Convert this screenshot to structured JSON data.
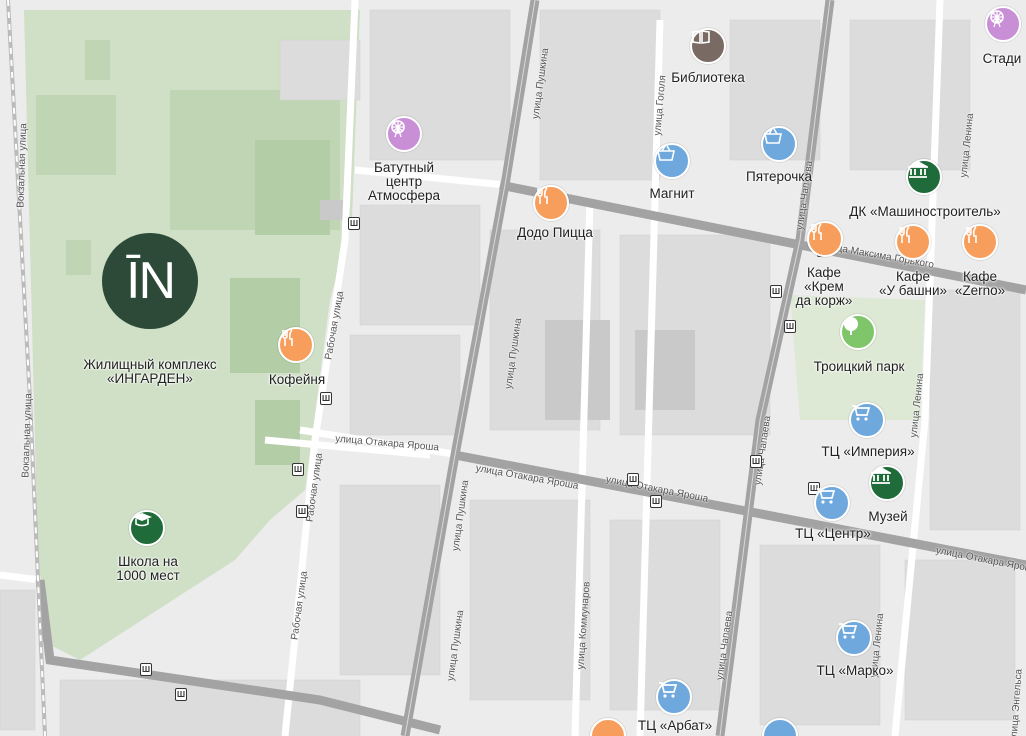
{
  "map": {
    "complex": {
      "logo_text": "ĪN",
      "label": "Жилищный комплекс\n«ИНГАРДЕН»"
    },
    "colors": {
      "park": "#cfe0c6",
      "road_major": "#9a9a9a",
      "block": "#dcdcdc",
      "food": "#f79e5c",
      "shop": "#6ea8dc",
      "culture": "#1f6b3a",
      "library": "#7a6a64",
      "fun": "#c98fd6",
      "park_icon": "#7fc66a"
    },
    "pois": [
      {
        "name": "Библиотека",
        "label": "Библиотека",
        "icon": "book-icon",
        "category": "library"
      },
      {
        "name": "Стадион",
        "label": "Стади",
        "icon": "ferris-wheel-icon",
        "category": "fun"
      },
      {
        "name": "Батутный центр",
        "label": "Батутный\nцентр\nАтмосфера",
        "icon": "ferris-wheel-icon",
        "category": "fun"
      },
      {
        "name": "Магнит",
        "label": "Магнит",
        "icon": "basket-icon",
        "category": "shop"
      },
      {
        "name": "Пятерочка",
        "label": "Пятерочка",
        "icon": "basket-icon",
        "category": "shop"
      },
      {
        "name": "ДК Машиностроитель",
        "label": "ДК «Машиностроитель»",
        "icon": "museum-icon",
        "category": "culture"
      },
      {
        "name": "Додо Пицца",
        "label": "Додо Пицца",
        "icon": "fork-knife-icon",
        "category": "food"
      },
      {
        "name": "Кафе Крем да корж",
        "label": "Кафе\n«Крем\nда корж»",
        "icon": "fork-knife-icon",
        "category": "food"
      },
      {
        "name": "Кафе У башни",
        "label": "Кафе\n«У башни»",
        "icon": "fork-knife-icon",
        "category": "food"
      },
      {
        "name": "Кафе Zerno",
        "label": "Кафе\n«Zerno»",
        "icon": "fork-knife-icon",
        "category": "food"
      },
      {
        "name": "Кофейня",
        "label": "Кофейня",
        "icon": "fork-knife-icon",
        "category": "food"
      },
      {
        "name": "Троицкий парк",
        "label": "Троицкий парк",
        "icon": "tree-icon",
        "category": "park_icon"
      },
      {
        "name": "ТЦ Империя",
        "label": "ТЦ «Империя»",
        "icon": "cart-icon",
        "category": "shop"
      },
      {
        "name": "Музей",
        "label": "Музей",
        "icon": "museum-icon",
        "category": "culture"
      },
      {
        "name": "ТЦ Центр",
        "label": "ТЦ «Центр»",
        "icon": "cart-icon",
        "category": "shop"
      },
      {
        "name": "Школа",
        "label": "Школа на\n1000 мест",
        "icon": "graduation-cap-icon",
        "category": "culture"
      },
      {
        "name": "ТЦ Марко",
        "label": "ТЦ «Марко»",
        "icon": "cart-icon",
        "category": "shop"
      },
      {
        "name": "ТЦ Арбат",
        "label": "ТЦ «Арбат»",
        "icon": "cart-icon",
        "category": "shop"
      }
    ],
    "streets": [
      "улица Пушкина",
      "Рабочая улица",
      "улица Отакара Яроша",
      "улица Гоголя",
      "улица Чапаева",
      "улица Максима Горького",
      "улица Ленина",
      "улица Коммунаров",
      "улица Энгельса",
      "Вокзальная улица"
    ]
  }
}
